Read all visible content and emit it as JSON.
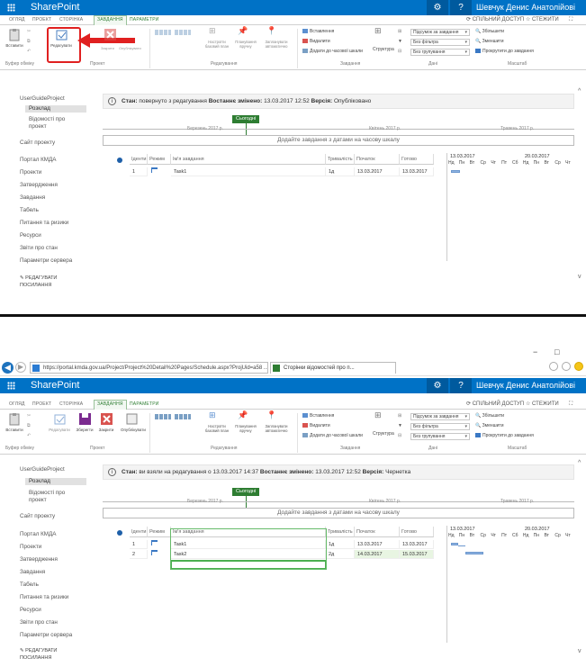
{
  "browser": {
    "url": "https://portal.kmda.gov.ua/Project/Project%20Detail%20Pages/Schedule.aspx?ProjUid=a58 ...",
    "tab_label": "Сторінки відомостей про п...",
    "minimize": "−",
    "maximize": "□"
  },
  "suite": {
    "app_title": "SharePoint",
    "gear": "⚙",
    "help": "?",
    "user": "Шевчук Денис Анатолійові"
  },
  "ribbon_tabs": [
    "ОГЛЯД",
    "ПРОЕКТ",
    "СТОРІНКА",
    "ЗАВДАННЯ",
    "ПАРАМЕТРИ"
  ],
  "share": "СПІЛЬНИЙ ДОСТУП",
  "follow": "СТЕЖИТИ",
  "ribbon": {
    "paste": "Вставити",
    "edit": "Редагувати",
    "save": "Зберегти",
    "close": "Закрити",
    "publish": "Опублікувати",
    "baseline": "Настроїти базовий план",
    "schedule_manual": "Планування вручну",
    "schedule_auto": "Запланувати автоматично",
    "insert": "Вставлення",
    "delete": "Видалити",
    "add_timeline": "Додати до часової шкали",
    "structure": "Структура",
    "sort": "Підсумок за завдання",
    "filter": "Без фільтра",
    "group": "Без групування",
    "zoom_in": "Збільшити",
    "zoom_out": "Зменшити",
    "scroll_task": "Прокрутити до завдання",
    "groups": {
      "clipboard": "Буфер обміну",
      "project": "Проект",
      "edit_grp": "Редагування",
      "tasks": "Завдання",
      "data": "Дані",
      "zoom": "Масштаб"
    }
  },
  "nav": {
    "project": "UserGuideProject",
    "schedule": "Розклад",
    "details": "Відомості про проект",
    "site": "Сайт проекту",
    "items": [
      "Портал КМДА",
      "Проекти",
      "Затвердження",
      "Завдання",
      "Табель",
      "Питання та ризики",
      "Ресурси",
      "Звіти про стан",
      "Параметри сервера"
    ],
    "edit_links": "РЕДАГУВАТИ ПОСИЛАННЯ"
  },
  "status1": {
    "label": "Стан:",
    "text": "повернуто з редагування",
    "changed_label": "Востаннє змінено:",
    "changed": "13.03.2017 12:52",
    "version_label": "Версія:",
    "version": "Опубліковано"
  },
  "status2": {
    "label": "Стан:",
    "text": "ви взяли на редагування о 13.03.2017 14:37",
    "changed_label": "Востаннє змінено:",
    "changed": "13.03.2017 12:52",
    "version_label": "Версія:",
    "version": "Чернетка"
  },
  "timeline": {
    "today": "Сьогодні",
    "months": [
      "Березень 2017 р.",
      "Квітень 2017 р.",
      "Травень 2017 р."
    ],
    "add_tasks": "Додайте завдання з датами на часову шкалу"
  },
  "grid": {
    "headers": [
      "Іденти",
      "Режим",
      "Ім'я завдання",
      "Тривалість",
      "Початок",
      "Готово"
    ],
    "rows1": [
      {
        "id": "1",
        "name": "Task1",
        "dur": "1д",
        "start": "13.03.2017",
        "finish": "13.03.2017"
      }
    ],
    "rows2": [
      {
        "id": "1",
        "name": "Task1",
        "dur": "1д",
        "start": "13.03.2017",
        "finish": "13.03.2017"
      },
      {
        "id": "2",
        "name": "Task2",
        "dur": "2д",
        "start": "14.03.2017",
        "finish": "15.03.2017"
      }
    ]
  },
  "gantt": {
    "week1": "13.03.2017",
    "week2": "20.03.2017",
    "days": [
      "Нд",
      "Пн",
      "Вт",
      "Ср",
      "Чт",
      "Пт",
      "Сб",
      "Нд",
      "Пн",
      "Вт",
      "Ср",
      "Чт"
    ]
  },
  "colors": {
    "suite": "#0072c6",
    "accent": "#2e7d32",
    "highlight": "#e02020"
  }
}
